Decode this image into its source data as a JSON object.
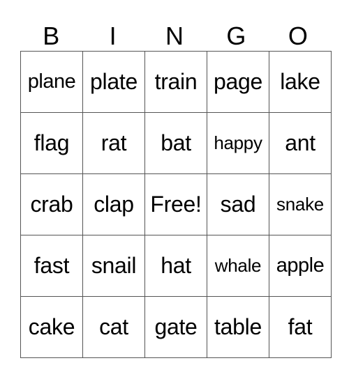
{
  "header": [
    "B",
    "I",
    "N",
    "G",
    "O"
  ],
  "rows": [
    [
      "plane",
      "plate",
      "train",
      "page",
      "lake"
    ],
    [
      "flag",
      "rat",
      "bat",
      "happy",
      "ant"
    ],
    [
      "crab",
      "clap",
      "Free!",
      "sad",
      "snake"
    ],
    [
      "fast",
      "snail",
      "hat",
      "whale",
      "apple"
    ],
    [
      "cake",
      "cat",
      "gate",
      "table",
      "fat"
    ]
  ]
}
